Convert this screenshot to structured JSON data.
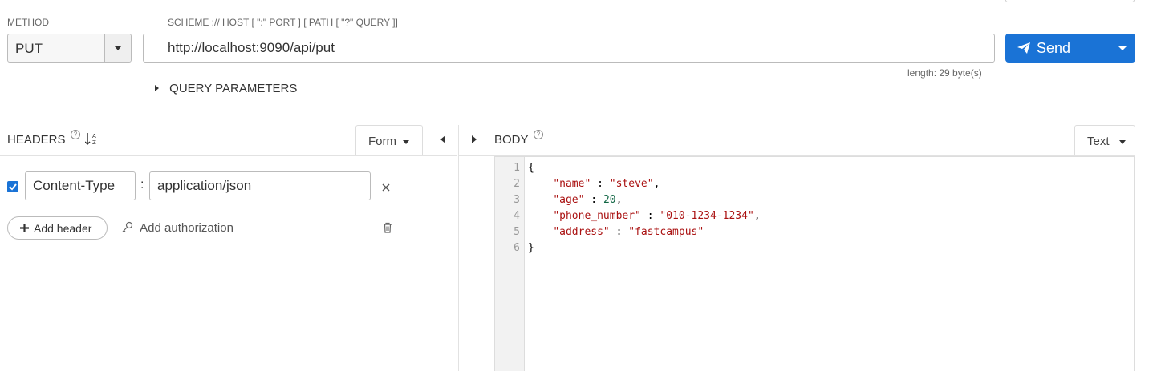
{
  "request": {
    "method_label": "METHOD",
    "method_value": "PUT",
    "url_hint": "SCHEME :// HOST [ \":\" PORT ] [ PATH [ \"?\" QUERY ]]",
    "url_value": "http://localhost:9090/api/put",
    "length_text": "length: 29 byte(s)",
    "send_label": "Send",
    "query_params_label": "QUERY PARAMETERS"
  },
  "headers": {
    "title": "HEADERS",
    "help": "?",
    "sort_icon": "sort-alpha-icon",
    "mode_label": "Form",
    "rows": [
      {
        "checked": true,
        "name": "Content-Type",
        "separator": ":",
        "value": "application/json"
      }
    ],
    "add_header_label": "Add header",
    "add_auth_label": "Add authorization"
  },
  "body": {
    "title": "BODY",
    "help": "?",
    "mode_label": "Text",
    "lines": [
      {
        "n": "1",
        "text": "{"
      },
      {
        "n": "2",
        "key": "\"name\"",
        "sep": " : ",
        "val": "\"steve\"",
        "valtype": "s",
        "tail": ","
      },
      {
        "n": "3",
        "key": "\"age\"",
        "sep": " : ",
        "val": "20",
        "valtype": "n",
        "tail": ","
      },
      {
        "n": "4",
        "key": "\"phone_number\"",
        "sep": " : ",
        "val": "\"010-1234-1234\"",
        "valtype": "s",
        "tail": ","
      },
      {
        "n": "5",
        "key": "\"address\"",
        "sep": " : ",
        "val": "\"fastcampus\"",
        "valtype": "s",
        "tail": ""
      },
      {
        "n": "6",
        "text": "}"
      }
    ]
  },
  "colors": {
    "accent": "#1a73d6",
    "json_string": "#aa1111",
    "json_number": "#116644"
  }
}
